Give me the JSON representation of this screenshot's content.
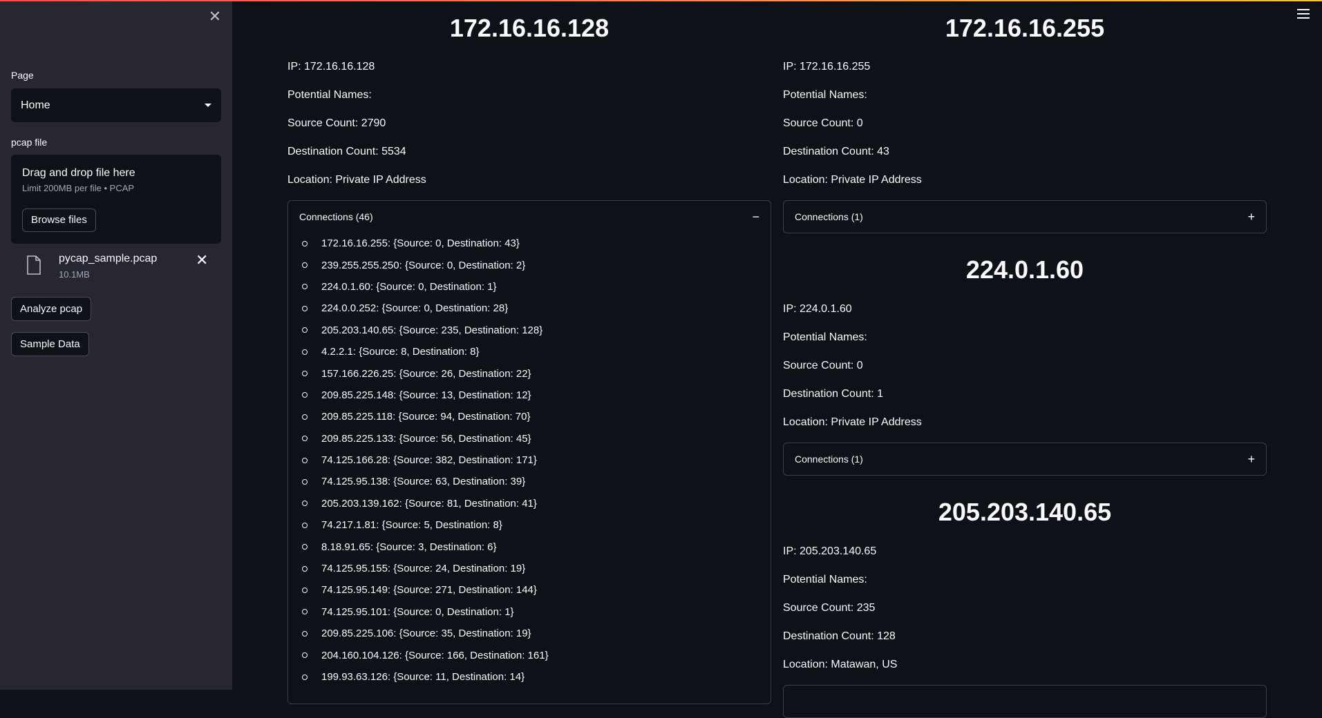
{
  "sidebar": {
    "page_label": "Page",
    "page_value": "Home",
    "pcap_label": "pcap file",
    "dropzone_title": "Drag and drop file here",
    "dropzone_limit": "Limit 200MB per file • PCAP",
    "browse_label": "Browse files",
    "file_name": "pycap_sample.pcap",
    "file_size": "10.1MB",
    "analyze_label": "Analyze pcap",
    "sample_label": "Sample Data"
  },
  "left": {
    "header": "172.16.16.128",
    "ip": "IP: 172.16.16.128",
    "names": "Potential Names:",
    "source": "Source Count: 2790",
    "dest": "Destination Count: 5534",
    "location": "Location: Private IP Address",
    "connections_label": "Connections (46)",
    "connections": [
      "172.16.16.255: {Source: 0, Destination: 43}",
      "239.255.255.250: {Source: 0, Destination: 2}",
      "224.0.1.60: {Source: 0, Destination: 1}",
      "224.0.0.252: {Source: 0, Destination: 28}",
      "205.203.140.65: {Source: 235, Destination: 128}",
      "4.2.2.1: {Source: 8, Destination: 8}",
      "157.166.226.25: {Source: 26, Destination: 22}",
      "209.85.225.148: {Source: 13, Destination: 12}",
      "209.85.225.118: {Source: 94, Destination: 70}",
      "209.85.225.133: {Source: 56, Destination: 45}",
      "74.125.166.28: {Source: 382, Destination: 171}",
      "74.125.95.138: {Source: 63, Destination: 39}",
      "205.203.139.162: {Source: 81, Destination: 41}",
      "74.217.1.81: {Source: 5, Destination: 8}",
      "8.18.91.65: {Source: 3, Destination: 6}",
      "74.125.95.155: {Source: 24, Destination: 19}",
      "74.125.95.149: {Source: 271, Destination: 144}",
      "74.125.95.101: {Source: 0, Destination: 1}",
      "209.85.225.106: {Source: 35, Destination: 19}",
      "204.160.104.126: {Source: 166, Destination: 161}",
      "199.93.63.126: {Source: 11, Destination: 14}"
    ]
  },
  "right": {
    "header1": "172.16.16.255",
    "ip1": "IP: 172.16.16.255",
    "names1": "Potential Names:",
    "source1": "Source Count: 0",
    "dest1": "Destination Count: 43",
    "location1": "Location: Private IP Address",
    "conn1": "Connections (1)",
    "header2": "224.0.1.60",
    "ip2": "IP: 224.0.1.60",
    "names2": "Potential Names:",
    "source2": "Source Count: 0",
    "dest2": "Destination Count: 1",
    "location2": "Location: Private IP Address",
    "conn2": "Connections (1)",
    "header3": "205.203.140.65",
    "ip3": "IP: 205.203.140.65",
    "names3": "Potential Names:",
    "source3": "Source Count: 235",
    "dest3": "Destination Count: 128",
    "location3": "Location: Matawan, US"
  },
  "icons": {
    "collapse": "−",
    "expand": "+",
    "close": "✕"
  }
}
